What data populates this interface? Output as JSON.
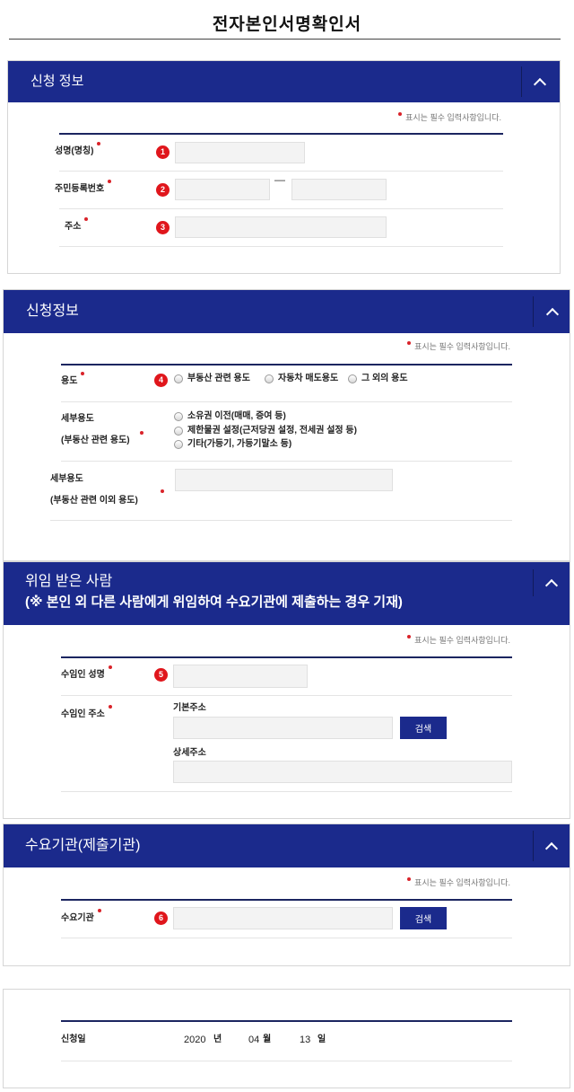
{
  "page": {
    "title": "전자본인서명확인서"
  },
  "required_note": "표시는 필수 입력사항입니다.",
  "colors": {
    "header": "#1b2a8c",
    "rule": "#1b2560",
    "badge": "#e0161c",
    "required": "#d9232a",
    "button": "#1b2a8c"
  },
  "icons": {
    "collapse": "chevron-up-icon",
    "required_marker": "red-dot-icon"
  },
  "applicant_info": {
    "title": "신청 정보",
    "name": {
      "label": "성명(명칭)",
      "step": "1",
      "value": ""
    },
    "resident_number": {
      "label": "주민등록번호",
      "step": "2",
      "separator": "—",
      "front_value": "",
      "back_value": ""
    },
    "address": {
      "label": "주소",
      "step": "3",
      "value": ""
    }
  },
  "application_info": {
    "title": "신청정보",
    "purpose": {
      "label": "용도",
      "step": "4",
      "options": [
        {
          "label": "부동산 관련 용도",
          "checked": false
        },
        {
          "label": "자동차 매도용도",
          "checked": false
        },
        {
          "label": "그 외의 용도",
          "checked": false
        }
      ]
    },
    "real_estate_detail": {
      "label_line1": "세부용도",
      "label_line2": "(부동산 관련 용도)",
      "options": [
        {
          "label": "소유권 이전(매매, 증여 등)",
          "checked": false
        },
        {
          "label": "제한물권 설정(근저당권 설정, 전세권 설정 등)",
          "checked": false
        },
        {
          "label": "기타(가등기, 가등기말소 등)",
          "checked": false
        }
      ]
    },
    "other_detail": {
      "label_line1": "세부용도",
      "label_line2": "(부동산 관련 이외 용도)",
      "value": ""
    }
  },
  "delegate": {
    "title_line1": "위임 받은 사람",
    "title_line2": "(※ 본인 외 다른 사람에게 위임하여 수요기관에 제출하는 경우 기재)",
    "name": {
      "label": "수임인 성명",
      "step": "5",
      "value": ""
    },
    "address": {
      "label": "수임인 주소",
      "basic_label": "기본주소",
      "basic_value": "",
      "search_button": "검색",
      "detail_label": "상세주소",
      "detail_value": ""
    }
  },
  "recipient_agency": {
    "title": "수요기관(제출기관)",
    "agency": {
      "label": "수요기관",
      "step": "6",
      "value": "",
      "search_button": "검색"
    }
  },
  "application_date": {
    "label": "신청일",
    "year": "2020",
    "year_unit": "년",
    "month": "04",
    "month_unit": "월",
    "day": "13",
    "day_unit": "일"
  }
}
